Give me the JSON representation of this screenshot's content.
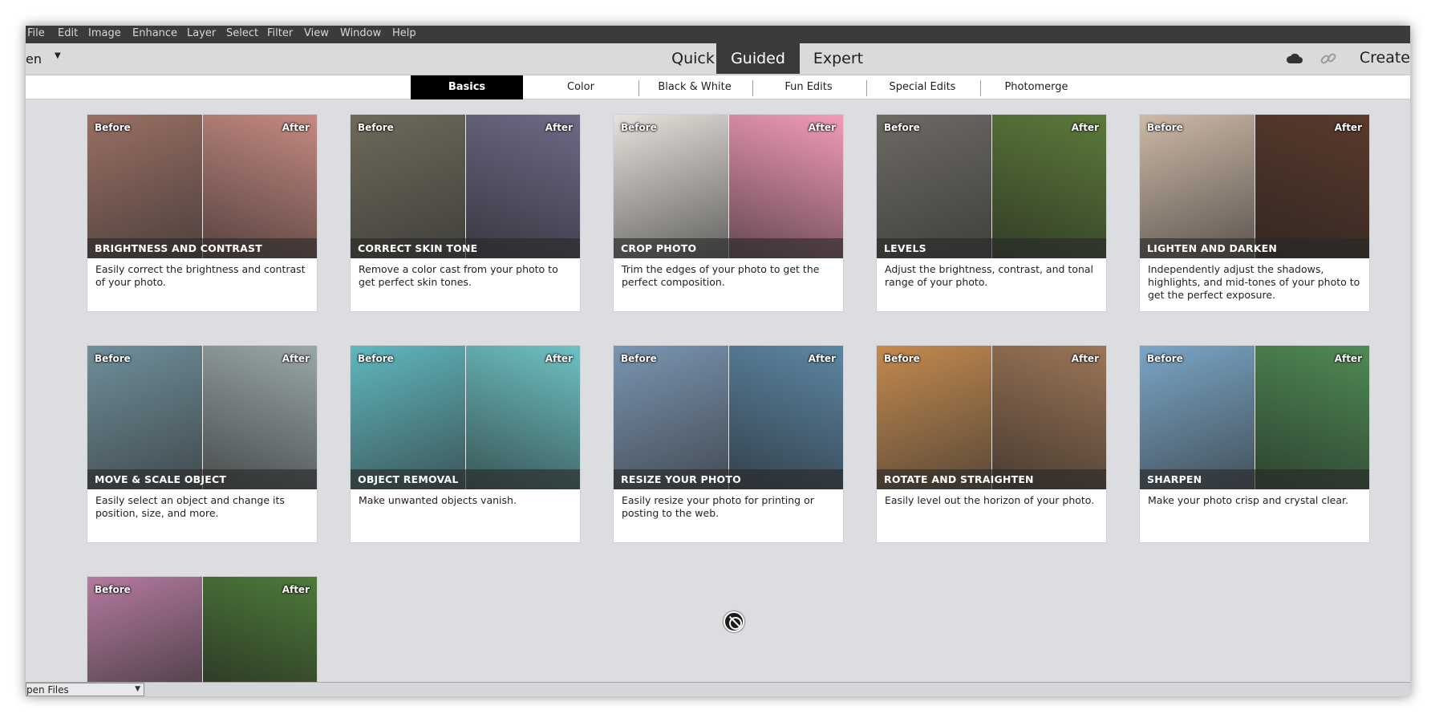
{
  "menu": [
    "File",
    "Edit",
    "Image",
    "Enhance",
    "Layer",
    "Select",
    "Filter",
    "View",
    "Window",
    "Help"
  ],
  "modebar": {
    "open_label": "en",
    "tabs": [
      "Quick",
      "Guided",
      "Expert"
    ],
    "active_tab": "Guided",
    "create_label": "Create"
  },
  "categories": {
    "tabs": [
      "Basics",
      "Color",
      "Black & White",
      "Fun Edits",
      "Special Edits",
      "Photomerge"
    ],
    "active": "Basics"
  },
  "labels": {
    "before": "Before",
    "after": "After"
  },
  "cards": [
    {
      "title": "BRIGHTNESS AND CONTRAST",
      "desc": "Easily correct the brightness and contrast of your photo.",
      "colors": [
        "#9a6f63",
        "#c58a82"
      ]
    },
    {
      "title": "CORRECT SKIN TONE",
      "desc": "Remove a color cast from your photo to get perfect skin tones.",
      "colors": [
        "#6e6a5a",
        "#6d6a86"
      ]
    },
    {
      "title": "CROP PHOTO",
      "desc": "Trim the edges of your photo to get the perfect composition.",
      "colors": [
        "#e6e2dc",
        "#f29bb8"
      ]
    },
    {
      "title": "LEVELS",
      "desc": "Adjust the brightness, contrast, and tonal range of your photo.",
      "colors": [
        "#6d6a64",
        "#5c7a3a"
      ]
    },
    {
      "title": "LIGHTEN AND DARKEN",
      "desc": "Independently adjust the shadows, highlights, and mid-tones of your photo to get the perfect exposure.",
      "colors": [
        "#cdb9a6",
        "#5a3a2c"
      ]
    },
    {
      "title": "MOVE & SCALE OBJECT",
      "desc": "Easily select an object and change its position, size, and more.",
      "colors": [
        "#6f8f9b",
        "#9aa7a8"
      ]
    },
    {
      "title": "OBJECT REMOVAL",
      "desc": "Make unwanted objects vanish.",
      "colors": [
        "#5fb8bf",
        "#6ec1c3"
      ]
    },
    {
      "title": "RESIZE YOUR PHOTO",
      "desc": "Easily resize your photo for printing or posting to the web.",
      "colors": [
        "#7a95b2",
        "#5d86a4"
      ]
    },
    {
      "title": "ROTATE AND STRAIGHTEN",
      "desc": "Easily level out the horizon of your photo.",
      "colors": [
        "#c48a4f",
        "#9b7557"
      ]
    },
    {
      "title": "SHARPEN",
      "desc": "Make your photo crisp and crystal clear.",
      "colors": [
        "#7aa6c7",
        "#4f8a55"
      ]
    },
    {
      "title": "",
      "desc": "",
      "colors": [
        "#b57aa0",
        "#4e7a3a"
      ]
    }
  ],
  "bottom": {
    "open_files_label": "pen Files"
  }
}
